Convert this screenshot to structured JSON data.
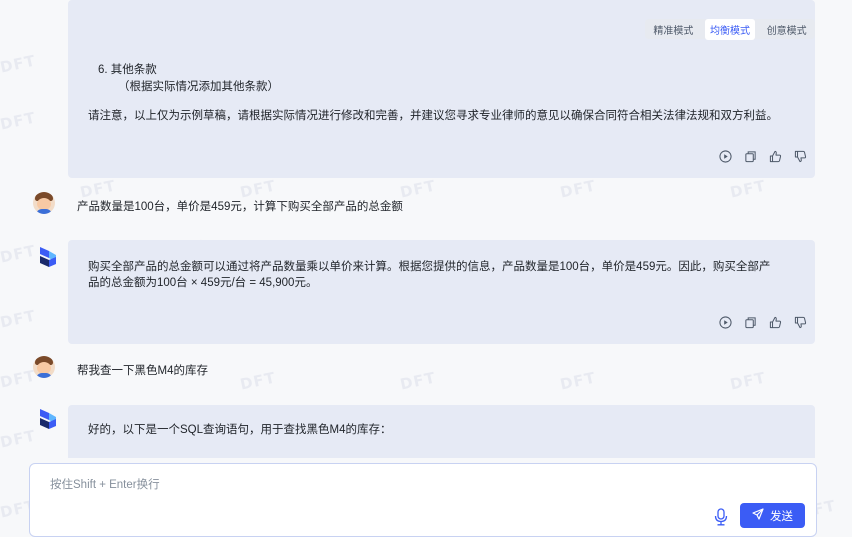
{
  "watermark": "DFT",
  "modes": [
    {
      "label": "精准模式",
      "active": false
    },
    {
      "label": "均衡模式",
      "active": true
    },
    {
      "label": "创意模式",
      "active": false
    }
  ],
  "messages": {
    "bot1": {
      "clause_title": "6. 其他条款",
      "clause_note": "（根据实际情况添加其他条款）",
      "notice": "请注意，以上仅为示例草稿，请根据实际情况进行修改和完善，并建议您寻求专业律师的意见以确保合同符合相关法律法规和双方利益。"
    },
    "user1": "产品数量是100台，单价是459元，计算下购买全部产品的总金额",
    "bot2": {
      "line1": "购买全部产品的总金额可以通过将产品数量乘以单价来计算。根据您提供的信息，产品数量是100台，单价是459元。因此，购买全部产",
      "line2": "品的总金额为100台 × 459元/台 = 45,900元。"
    },
    "user2": "帮我查一下黑色M4的库存",
    "bot3": "好的，以下是一个SQL查询语句，用于查找黑色M4的库存："
  },
  "icons": {
    "play": "play-circle-icon",
    "copy": "copy-icon",
    "like": "thumbs-up-icon",
    "dislike": "thumbs-down-icon",
    "mic": "microphone-icon",
    "send": "send-icon"
  },
  "input": {
    "placeholder": "按住Shift + Enter换行",
    "value": ""
  },
  "send_label": "发送",
  "colors": {
    "accent": "#3b5cf5",
    "bubble": "#e6eaf5",
    "background": "#f7f8fa"
  }
}
